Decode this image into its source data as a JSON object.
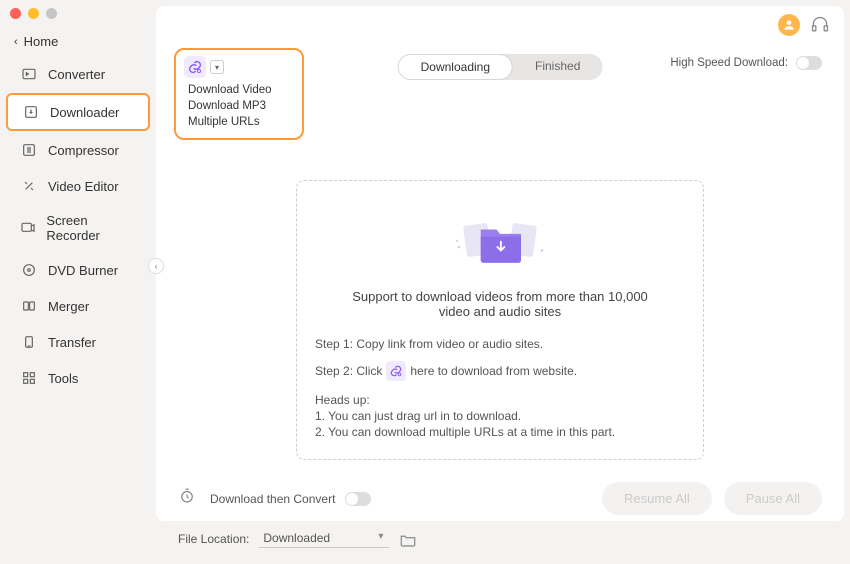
{
  "sidebar": {
    "home": "Home",
    "items": [
      {
        "label": "Converter"
      },
      {
        "label": "Downloader"
      },
      {
        "label": "Compressor"
      },
      {
        "label": "Video Editor"
      },
      {
        "label": "Screen Recorder"
      },
      {
        "label": "DVD Burner"
      },
      {
        "label": "Merger"
      },
      {
        "label": "Transfer"
      },
      {
        "label": "Tools"
      }
    ]
  },
  "dropdown": {
    "items": [
      {
        "label": "Download Video"
      },
      {
        "label": "Download MP3"
      },
      {
        "label": "Multiple URLs"
      }
    ]
  },
  "tabs": {
    "downloading": "Downloading",
    "finished": "Finished"
  },
  "hsd_label": "High Speed Download:",
  "content": {
    "support_text": "Support to download videos from more than 10,000 video and audio sites",
    "step1": "Step 1: Copy link from video or audio sites.",
    "step2_a": "Step 2: Click",
    "step2_b": "here to download from website.",
    "heads_up": "Heads up:",
    "note1": "1. You can just drag url in to download.",
    "note2": "2. You can download multiple URLs at a time in this part."
  },
  "footer": {
    "dtc": "Download then Convert",
    "file_loc_label": "File Location:",
    "file_loc_value": "Downloaded",
    "resume": "Resume All",
    "pause": "Pause All"
  }
}
